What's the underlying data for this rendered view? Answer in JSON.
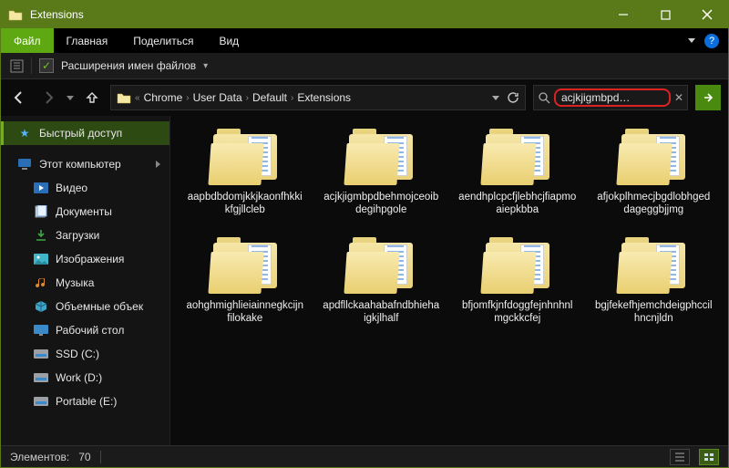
{
  "title": "Extensions",
  "menu": {
    "file": "Файл",
    "home": "Главная",
    "share": "Поделиться",
    "view": "Вид"
  },
  "ribbon": {
    "ext_label": "Расширения имен файлов"
  },
  "breadcrumbs": [
    "Chrome",
    "User Data",
    "Default",
    "Extensions"
  ],
  "search": {
    "value": "acjkjigmbpd…"
  },
  "sidebar": {
    "quick": "Быстрый доступ",
    "thispc": "Этот компьютер",
    "items": [
      {
        "label": "Видео"
      },
      {
        "label": "Документы"
      },
      {
        "label": "Загрузки"
      },
      {
        "label": "Изображения"
      },
      {
        "label": "Музыка"
      },
      {
        "label": "Объемные объек"
      },
      {
        "label": "Рабочий стол"
      },
      {
        "label": "SSD (C:)"
      },
      {
        "label": "Work (D:)"
      },
      {
        "label": "Portable (E:)"
      }
    ]
  },
  "folders": [
    "aapbdbdomjkkjkaonfhkkikfgjllcleb",
    "acjkjigmbpdbehmojceoibdegihpgole",
    "aendhplcpcfjlebhcjfiapmoaiepkbba",
    "afjokplhmecjbgdlobhgeddageggbjjmg",
    "aohghmighlieiainnegkcijnfilokake",
    "apdfllckaahabafndbhiehaigkjlhalf",
    "bfjomfkjnfdoggfejnhnhnlmgckkcfej",
    "bgjfekefhjemchdeigphccilhncnjldn"
  ],
  "status": {
    "count_label": "Элементов:",
    "count": "70"
  }
}
